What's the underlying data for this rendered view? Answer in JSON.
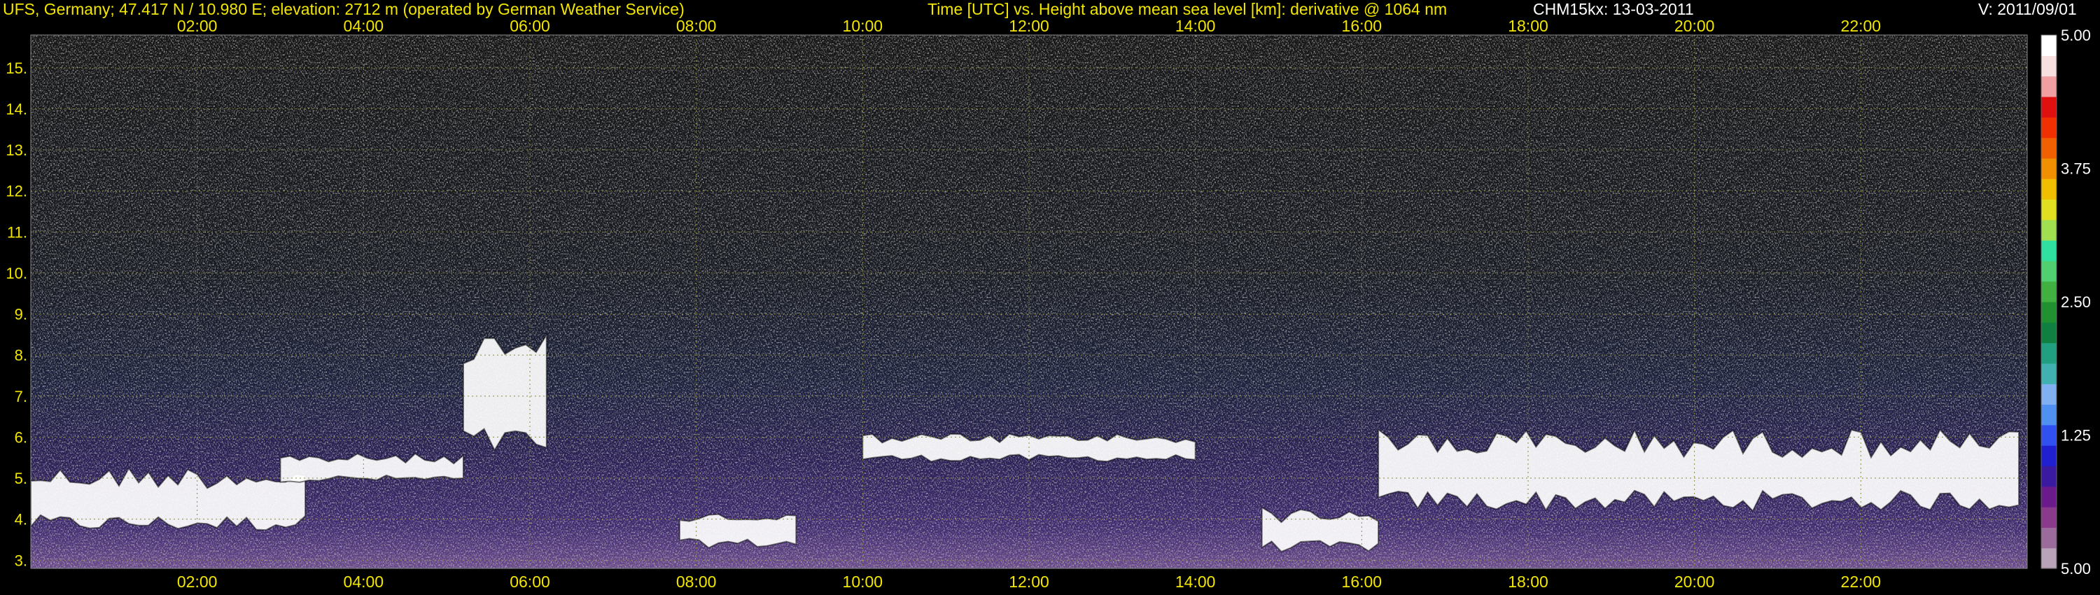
{
  "header": {
    "site": "UFS, Germany; 47.417 N / 10.980 E; elevation: 2712 m  (operated by German Weather Service)",
    "axes_desc": "Time [UTC] vs. Height above mean sea level [km]: derivative @ 1064 nm",
    "instrument_date": "CHM15kx: 13-03-2011",
    "version": "V: 2011/09/01"
  },
  "colors": {
    "background": "#000000",
    "text_yellow": "#f2e600",
    "grid": "#8a8a3a",
    "cloud": "#ffffff",
    "aerosol_purple": "#5a2a8a"
  },
  "chart_data": {
    "type": "heatmap",
    "title": "Time [UTC] vs. Height above mean sea level [km]: derivative @ 1064 nm",
    "x": {
      "label": "Time [UTC]",
      "range": [
        0,
        24
      ],
      "ticks": [
        2,
        4,
        6,
        8,
        10,
        12,
        14,
        16,
        18,
        20,
        22
      ],
      "tick_labels": [
        "02:00",
        "04:00",
        "06:00",
        "08:00",
        "10:00",
        "12:00",
        "14:00",
        "16:00",
        "18:00",
        "20:00",
        "22:00"
      ]
    },
    "y": {
      "label": "Height above mean sea level [km]",
      "range": [
        2.8,
        15.8
      ],
      "ticks": [
        3,
        4,
        5,
        6,
        7,
        8,
        9,
        10,
        11,
        12,
        13,
        14,
        15
      ],
      "tick_labels": [
        "3.",
        "4.",
        "5.",
        "6.",
        "7.",
        "8.",
        "9.",
        "10.",
        "11.",
        "12.",
        "13.",
        "14.",
        "15."
      ]
    },
    "grid": true,
    "colorbar": {
      "range": [
        5.0,
        5.0
      ],
      "tick_labels": [
        "5.00",
        "3.75",
        "2.50",
        "1.25",
        "5.00"
      ],
      "colors": [
        "#b8a3b8",
        "#9b6b9b",
        "#8a3a8a",
        "#6a1a8a",
        "#3a1aa0",
        "#2020d0",
        "#3050f0",
        "#5090f0",
        "#80b0f0",
        "#40b0b0",
        "#20a080",
        "#108040",
        "#209030",
        "#40b040",
        "#50d070",
        "#30e0a0",
        "#a0e050",
        "#e0e020",
        "#f0c000",
        "#f09000",
        "#f06000",
        "#f03000",
        "#e01010",
        "#f0a0a0",
        "#f8e0e0",
        "#ffffff"
      ]
    },
    "cloud_layers": [
      {
        "t": [
          0.0,
          3.3
        ],
        "base_km": 3.7,
        "top_km": 5.3
      },
      {
        "t": [
          3.0,
          5.2
        ],
        "base_km": 4.9,
        "top_km": 5.6
      },
      {
        "t": [
          5.2,
          6.2
        ],
        "base_km": 5.5,
        "top_km": 8.5
      },
      {
        "t": [
          7.8,
          9.2
        ],
        "base_km": 3.3,
        "top_km": 4.2
      },
      {
        "t": [
          10.0,
          14.0
        ],
        "base_km": 5.4,
        "top_km": 6.1
      },
      {
        "t": [
          14.8,
          16.2
        ],
        "base_km": 3.2,
        "top_km": 4.3
      },
      {
        "t": [
          16.2,
          23.9
        ],
        "base_km": 4.2,
        "top_km": 6.2
      }
    ]
  }
}
